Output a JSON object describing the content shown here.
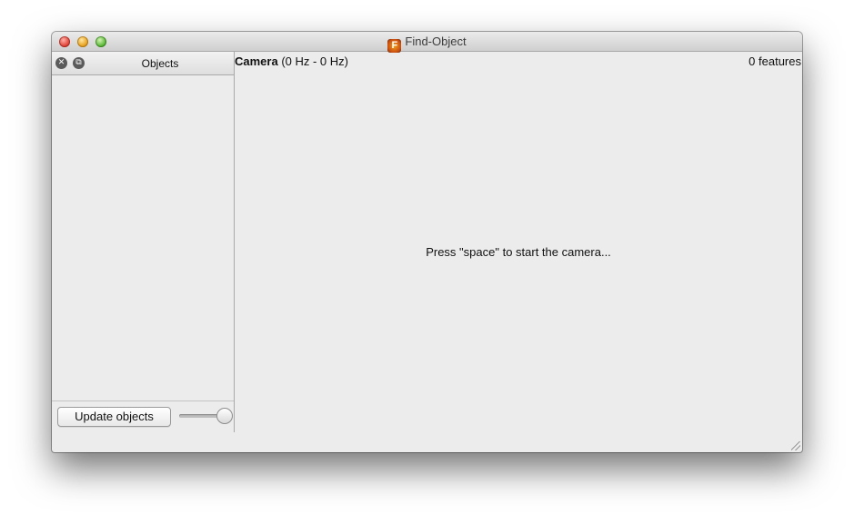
{
  "window": {
    "title": "Find-Object",
    "app_icon_letter": "F"
  },
  "dock": {
    "title": "Objects",
    "close_glyph": "✕",
    "float_glyph": "⧉",
    "update_button_label": "Update objects",
    "slider_level": 1.0
  },
  "camera": {
    "label_bold": "Camera",
    "label_rate": " (0 Hz - 0 Hz)",
    "features": "0 features",
    "hint": "Press \"space\" to start the camera..."
  }
}
